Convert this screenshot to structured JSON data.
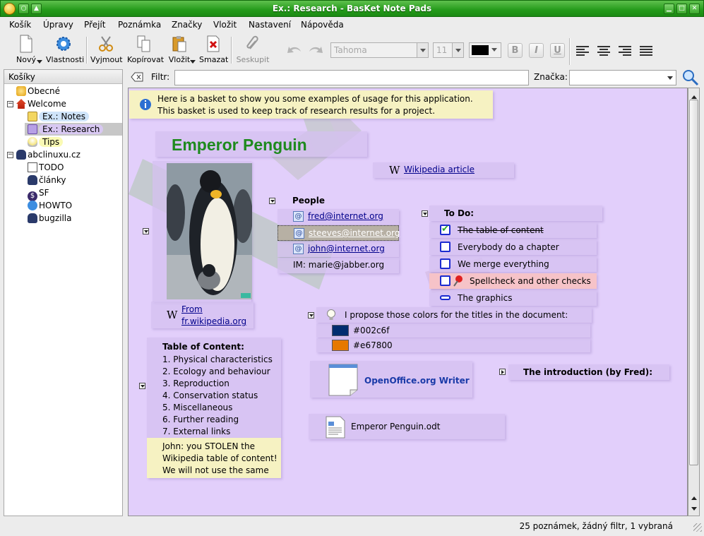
{
  "window": {
    "title": "Ex.: Research - BasKet Note Pads"
  },
  "menu": [
    "Košík",
    "Úpravy",
    "Přejít",
    "Poznámka",
    "Značky",
    "Vložit",
    "Nastavení",
    "Nápověda"
  ],
  "toolbar": {
    "new": "Nový",
    "properties": "Vlastnosti",
    "cut": "Vyjmout",
    "copy": "Kopírovat",
    "paste": "Vložit",
    "delete": "Smazat",
    "group": "Seskupit",
    "font_value": "Tahoma",
    "size_value": "11",
    "bold": "B",
    "italic": "I",
    "underline": "U"
  },
  "sidebar": {
    "header": "Košíky",
    "items": [
      {
        "label": "Obecné"
      },
      {
        "label": "Welcome"
      },
      {
        "label": "Ex.: Notes"
      },
      {
        "label": "Ex.: Research"
      },
      {
        "label": "Tips"
      },
      {
        "label": "abclinuxu.cz"
      },
      {
        "label": "TODO"
      },
      {
        "label": "články"
      },
      {
        "label": "SF"
      },
      {
        "label": "HOWTO"
      },
      {
        "label": "bugzilla"
      }
    ]
  },
  "filter": {
    "label": "Filtr:",
    "value": "",
    "tag_label": "Značka:",
    "tag_value": ""
  },
  "notes": {
    "intro_line1": "Here is a basket to show you some examples of usage for this application.",
    "intro_line2": "This basket is used to keep track of research results for a project.",
    "title": "Emperor Penguin",
    "wikipedia_article": "Wikipedia article",
    "from_line1": "From",
    "from_line2": "fr.wikipedia.org",
    "people": {
      "heading": "People",
      "emails": [
        "fred@internet.org",
        "steeves@internet.org",
        "john@internet.org"
      ],
      "im": "IM: marie@jabber.org"
    },
    "todo": {
      "heading": "To Do:",
      "items": [
        "The table of content",
        "Everybody do a chapter",
        "We merge everything",
        "Spellcheck and other checks",
        "The graphics"
      ]
    },
    "colors": {
      "heading": "I propose those colors for the titles in the document:",
      "items": [
        {
          "hex": "#002c6f"
        },
        {
          "hex": "#e67800"
        }
      ]
    },
    "toc": {
      "heading": "Table of Content:",
      "items": [
        "1. Physical characteristics",
        "2. Ecology and behaviour",
        "3. Reproduction",
        "4. Conservation status",
        "5. Miscellaneous",
        "6. Further reading",
        "7. External links"
      ]
    },
    "comment": [
      "John: you STOLEN the",
      "Wikipedia table of content!",
      "We will not use the same"
    ],
    "app_launcher": "OpenOffice.org Writer",
    "introduction": "The introduction (by Fred):",
    "file": "Emperor Penguin.odt"
  },
  "status": {
    "text": "25 poznámek, žádný filtr,   1 vybraná"
  },
  "colors": {
    "title_green": "#1e8a1e",
    "canvas_bg": "#e2cffb",
    "titlebar_green": "#2a9e1e",
    "selected_item": "#d4c0ee"
  }
}
